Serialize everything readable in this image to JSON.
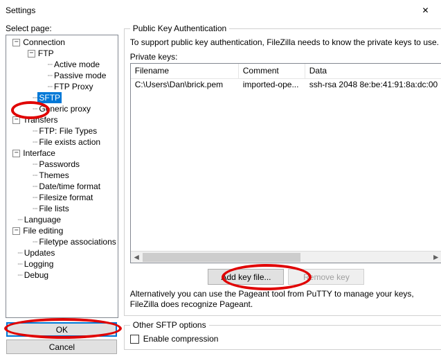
{
  "window": {
    "title": "Settings",
    "close": "✕"
  },
  "left": {
    "select_label": "Select page:",
    "tree": {
      "connection": "Connection",
      "ftp": "FTP",
      "active_mode": "Active mode",
      "passive_mode": "Passive mode",
      "ftp_proxy": "FTP Proxy",
      "sftp": "SFTP",
      "generic_proxy": "Generic proxy",
      "transfers": "Transfers",
      "ftp_file_types": "FTP: File Types",
      "file_exists_action": "File exists action",
      "interface": "Interface",
      "passwords": "Passwords",
      "themes": "Themes",
      "date_time_format": "Date/time format",
      "filesize_format": "Filesize format",
      "file_lists": "File lists",
      "language": "Language",
      "file_editing": "File editing",
      "filetype_assoc": "Filetype associations",
      "updates": "Updates",
      "logging": "Logging",
      "debug": "Debug"
    },
    "ok": "OK",
    "cancel": "Cancel"
  },
  "right": {
    "group_title": "Public Key Authentication",
    "description": "To support public key authentication, FileZilla needs to know the private keys to use.",
    "pk_label": "Private keys:",
    "columns": {
      "filename": "Filename",
      "comment": "Comment",
      "data": "Data"
    },
    "rows": [
      {
        "filename": "C:\\Users\\Dan\\brick.pem",
        "comment": "imported-ope...",
        "data": "ssh-rsa 2048 8e:be:41:91:8a:dc:00"
      }
    ],
    "add_key": "Add key file...",
    "remove_key": "Remove key",
    "alt_text": "Alternatively you can use the Pageant tool from PuTTY to manage your keys, FileZilla does recognize Pageant.",
    "other_group": "Other SFTP options",
    "enable_compression": "Enable compression"
  }
}
